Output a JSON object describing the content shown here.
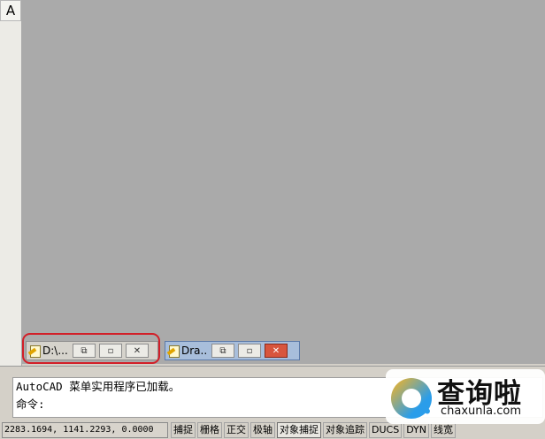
{
  "left_toolbar": {
    "button_label": "A"
  },
  "minimized_windows": [
    {
      "title": "D:\\...",
      "buttons": [
        "restore",
        "maximize",
        "close"
      ]
    },
    {
      "title": "Dra...",
      "buttons": [
        "restore",
        "maximize",
        "close"
      ]
    }
  ],
  "command": {
    "lines": [
      "AutoCAD 菜单实用程序已加载。",
      "命令:"
    ]
  },
  "status_bar": {
    "coordinates": "2283.1694, 1141.2293, 0.0000",
    "toggles": [
      "捕捉",
      "栅格",
      "正交",
      "极轴",
      "对象捕捉",
      "对象追踪",
      "DUCS",
      "DYN",
      "线宽"
    ]
  },
  "watermark": {
    "title": "查询啦",
    "subtitle": "chaxunla.com"
  },
  "colors": {
    "workspace": "#aaaaaa",
    "highlight": "#d21f28",
    "active_close": "#d8553d"
  },
  "icons": [
    "document-icon",
    "restore-icon",
    "maximize-icon",
    "close-icon"
  ]
}
